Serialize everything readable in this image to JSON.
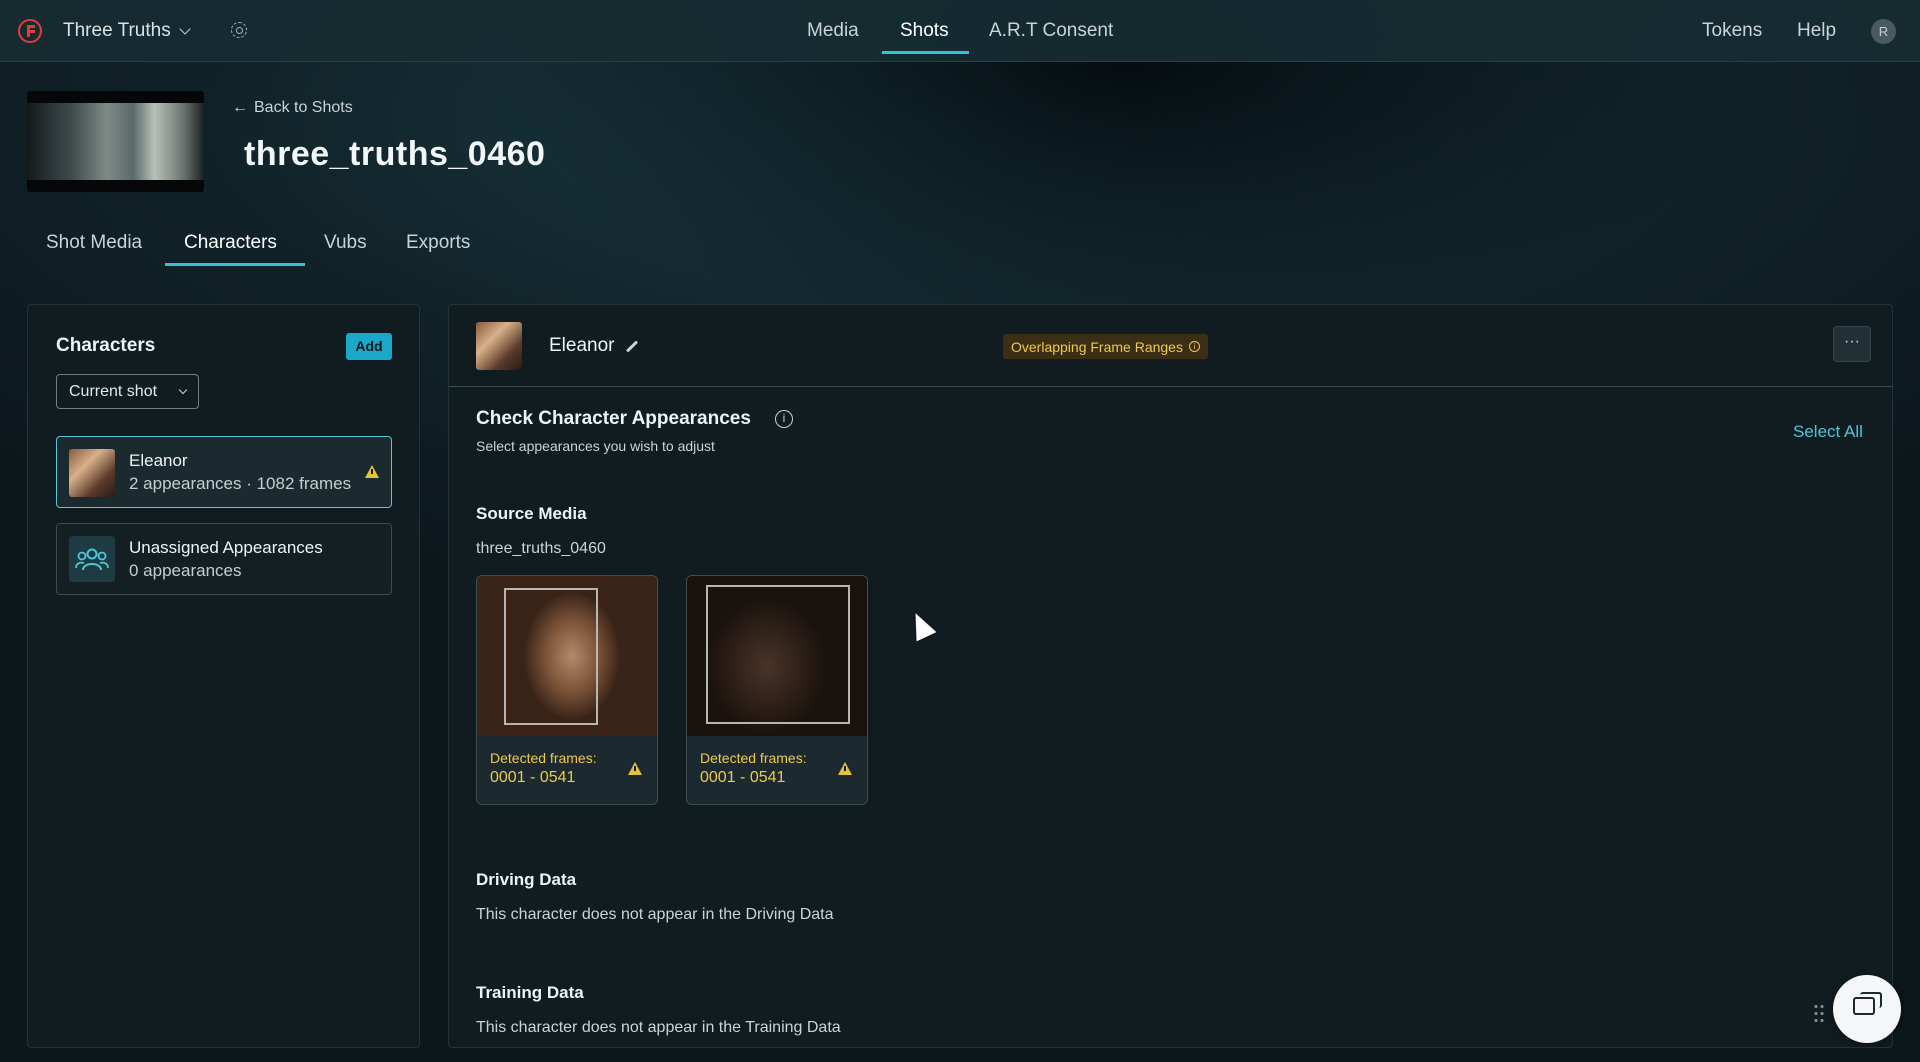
{
  "app": {
    "project_name": "Three Truths",
    "accent_color": "#36c2d6",
    "warning_color": "#e8c13a"
  },
  "nav": {
    "tabs": [
      {
        "label": "Media",
        "active": false
      },
      {
        "label": "Shots",
        "active": true
      },
      {
        "label": "A.R.T Consent",
        "active": false
      }
    ],
    "right": {
      "tokens": "Tokens",
      "help": "Help",
      "avatar_initial": "R"
    }
  },
  "shot": {
    "back_label": "Back to Shots",
    "title": "three_truths_0460",
    "tabs": [
      {
        "label": "Shot Media",
        "active": false
      },
      {
        "label": "Characters",
        "active": true
      },
      {
        "label": "Vubs",
        "active": false
      },
      {
        "label": "Exports",
        "active": false
      }
    ]
  },
  "characters_panel": {
    "title": "Characters",
    "add_label": "Add",
    "filter_value": "Current shot",
    "items": [
      {
        "name": "Eleanor",
        "sub": "2 appearances · 1082 frames",
        "selected": true,
        "warning": true,
        "icon": "character-thumbnail"
      },
      {
        "name": "Unassigned Appearances",
        "sub": "0 appearances",
        "selected": false,
        "warning": false,
        "icon": "group-icon"
      }
    ]
  },
  "detail": {
    "character_name": "Eleanor",
    "badge": "Overlapping Frame Ranges",
    "more_label": "···",
    "check": {
      "title": "Check Character Appearances",
      "subtitle": "Select appearances you wish to adjust",
      "select_all": "Select All"
    },
    "source_media": {
      "title": "Source Media",
      "file": "three_truths_0460",
      "appearances": [
        {
          "label": "Detected frames:",
          "range": "0001 - 0541",
          "warning": true
        },
        {
          "label": "Detected frames:",
          "range": "0001 - 0541",
          "warning": true
        }
      ]
    },
    "driving": {
      "title": "Driving Data",
      "text": "This character does not appear in the Driving Data"
    },
    "training": {
      "title": "Training Data",
      "text": "This character does not appear in the Training Data"
    }
  }
}
